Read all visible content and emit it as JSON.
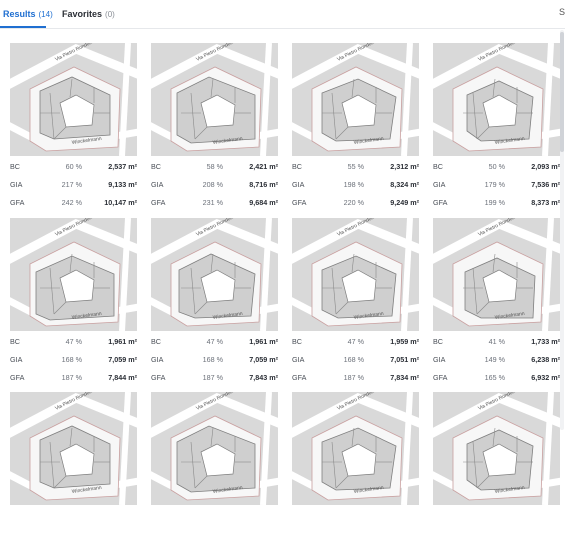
{
  "tabs": [
    {
      "label": "Results",
      "count": "(14)"
    },
    {
      "label": "Favorites",
      "count": "(0)"
    }
  ],
  "edge_glyph": "S",
  "plan_labels": {
    "street_top": "Via Pietro Rondoni",
    "street_bottom": "Winckelmann"
  },
  "cards": [
    {
      "metrics": [
        {
          "k": "BC",
          "p": "60 %",
          "v": "2,537 m²"
        },
        {
          "k": "GIA",
          "p": "217 %",
          "v": "9,133 m²"
        },
        {
          "k": "GFA",
          "p": "242 %",
          "v": "10,147 m²"
        }
      ]
    },
    {
      "metrics": [
        {
          "k": "BC",
          "p": "58 %",
          "v": "2,421 m²"
        },
        {
          "k": "GIA",
          "p": "208 %",
          "v": "8,716 m²"
        },
        {
          "k": "GFA",
          "p": "231 %",
          "v": "9,684 m²"
        }
      ]
    },
    {
      "metrics": [
        {
          "k": "BC",
          "p": "55 %",
          "v": "2,312 m²"
        },
        {
          "k": "GIA",
          "p": "198 %",
          "v": "8,324 m²"
        },
        {
          "k": "GFA",
          "p": "220 %",
          "v": "9,249 m²"
        }
      ]
    },
    {
      "metrics": [
        {
          "k": "BC",
          "p": "50 %",
          "v": "2,093 m²"
        },
        {
          "k": "GIA",
          "p": "179 %",
          "v": "7,536 m²"
        },
        {
          "k": "GFA",
          "p": "199 %",
          "v": "8,373 m²"
        }
      ]
    },
    {
      "metrics": [
        {
          "k": "BC",
          "p": "47 %",
          "v": "1,961 m²"
        },
        {
          "k": "GIA",
          "p": "168 %",
          "v": "7,059 m²"
        },
        {
          "k": "GFA",
          "p": "187 %",
          "v": "7,844 m²"
        }
      ]
    },
    {
      "metrics": [
        {
          "k": "BC",
          "p": "47 %",
          "v": "1,961 m²"
        },
        {
          "k": "GIA",
          "p": "168 %",
          "v": "7,059 m²"
        },
        {
          "k": "GFA",
          "p": "187 %",
          "v": "7,843 m²"
        }
      ]
    },
    {
      "metrics": [
        {
          "k": "BC",
          "p": "47 %",
          "v": "1,959 m²"
        },
        {
          "k": "GIA",
          "p": "168 %",
          "v": "7,051 m²"
        },
        {
          "k": "GFA",
          "p": "187 %",
          "v": "7,834 m²"
        }
      ]
    },
    {
      "metrics": [
        {
          "k": "BC",
          "p": "41 %",
          "v": "1,733 m²"
        },
        {
          "k": "GIA",
          "p": "149 %",
          "v": "6,238 m²"
        },
        {
          "k": "GFA",
          "p": "165 %",
          "v": "6,932 m²"
        }
      ]
    },
    {
      "metrics": []
    },
    {
      "metrics": []
    },
    {
      "metrics": []
    },
    {
      "metrics": []
    }
  ]
}
